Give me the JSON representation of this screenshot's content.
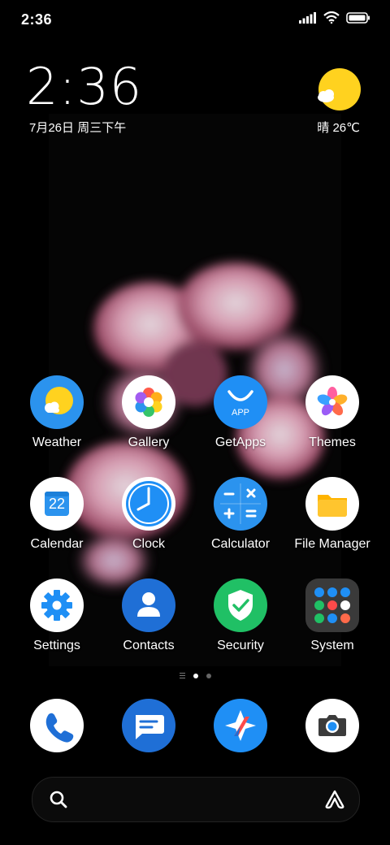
{
  "status_bar": {
    "time": "2:36"
  },
  "clock_widget": {
    "time": "2:36",
    "date": "7月26日 周三下午"
  },
  "weather_widget": {
    "text": "晴 26℃"
  },
  "apps": [
    {
      "label": "Weather",
      "icon": "weather-icon"
    },
    {
      "label": "Gallery",
      "icon": "gallery-icon"
    },
    {
      "label": "GetApps",
      "icon": "getapps-icon",
      "badge": "APP"
    },
    {
      "label": "Themes",
      "icon": "themes-icon"
    },
    {
      "label": "Calendar",
      "icon": "calendar-icon",
      "day": "22"
    },
    {
      "label": "Clock",
      "icon": "clock-icon"
    },
    {
      "label": "Calculator",
      "icon": "calculator-icon"
    },
    {
      "label": "File Manager",
      "icon": "folder-icon"
    },
    {
      "label": "Settings",
      "icon": "gear-icon"
    },
    {
      "label": "Contacts",
      "icon": "person-icon"
    },
    {
      "label": "Security",
      "icon": "shield-icon"
    },
    {
      "label": "System",
      "icon": "folder-grid-icon"
    }
  ],
  "dock": [
    {
      "icon": "phone-icon"
    },
    {
      "icon": "messages-icon"
    },
    {
      "icon": "browser-icon"
    },
    {
      "icon": "camera-icon"
    }
  ],
  "colors": {
    "accent_blue": "#1f8ff5",
    "sun_yellow": "#ffd21f",
    "green": "#20c065"
  }
}
